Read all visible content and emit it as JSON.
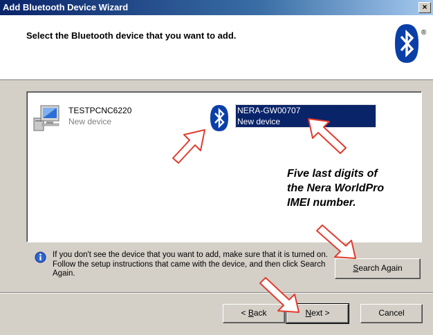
{
  "window": {
    "title": "Add Bluetooth Device Wizard",
    "close_glyph": "×"
  },
  "header": {
    "heading": "Select the Bluetooth device that you want to add.",
    "registered_mark": "®"
  },
  "devices": [
    {
      "name": "TESTPCNC6220",
      "status": "New device",
      "icon": "computer-icon",
      "selected": false
    },
    {
      "name": "NERA-GW00707",
      "status": "New device",
      "icon": "bluetooth-icon",
      "selected": true
    }
  ],
  "annotation": {
    "lines": [
      "Five last digits of",
      "the Nera WorldPro",
      "IMEI number."
    ]
  },
  "hint": {
    "text": "If you don't see the device that you want to add, make sure that it is turned on. Follow the setup instructions that came with the device, and then click Search Again."
  },
  "buttons": {
    "search_again": {
      "mnemonic": "S",
      "rest": "earch Again"
    },
    "back": {
      "prefix": "< ",
      "mnemonic": "B",
      "rest": "ack"
    },
    "next": {
      "mnemonic": "N",
      "rest": "ext >"
    },
    "cancel": "Cancel"
  },
  "colors": {
    "selection": "#0a246a",
    "dialog_face": "#d4d0c8",
    "bluetooth_blue": "#0a3fa8",
    "arrow_red": "#e23b2e"
  }
}
